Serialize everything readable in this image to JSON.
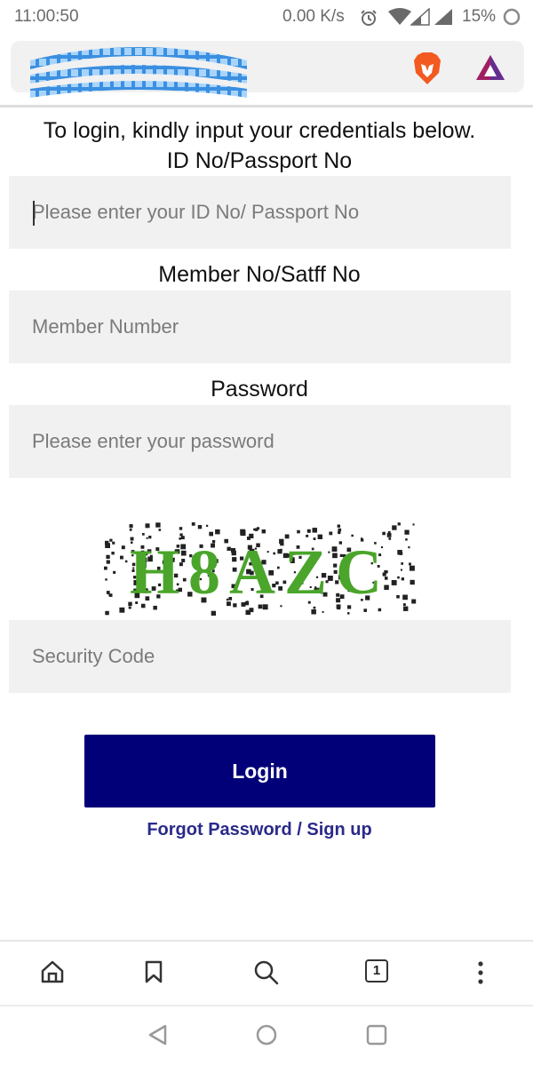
{
  "status_bar": {
    "time": "11:00:50",
    "network_speed": "0.00 K/s",
    "battery": "15%"
  },
  "browser": {
    "icons": [
      "site-logo",
      "brave-lion-icon",
      "bat-triangle-icon"
    ]
  },
  "form": {
    "intro": "To login, kindly input your credentials below.",
    "id_label": "ID No/Passport No",
    "id_placeholder": "Please enter your ID No/ Passport No",
    "member_label": "Member No/Satff No",
    "member_placeholder": "Member Number",
    "password_label": "Password",
    "password_placeholder": "Please enter your password",
    "captcha_text": "H8AZC",
    "security_placeholder": "Security Code",
    "login_label": "Login",
    "forgot_link": "Forgot Password / Sign up"
  },
  "toolbar": {
    "tab_count": "1",
    "icons": [
      "home-icon",
      "bookmark-icon",
      "search-icon",
      "tabs-icon",
      "more-icon"
    ]
  },
  "navbar": {
    "icons": [
      "back-icon",
      "home-circle-icon",
      "recents-icon"
    ]
  },
  "colors": {
    "login_button": "#020078",
    "link": "#2a2a8a",
    "input_bg": "#f1f1f1",
    "captcha_green": "#4aa52a"
  }
}
